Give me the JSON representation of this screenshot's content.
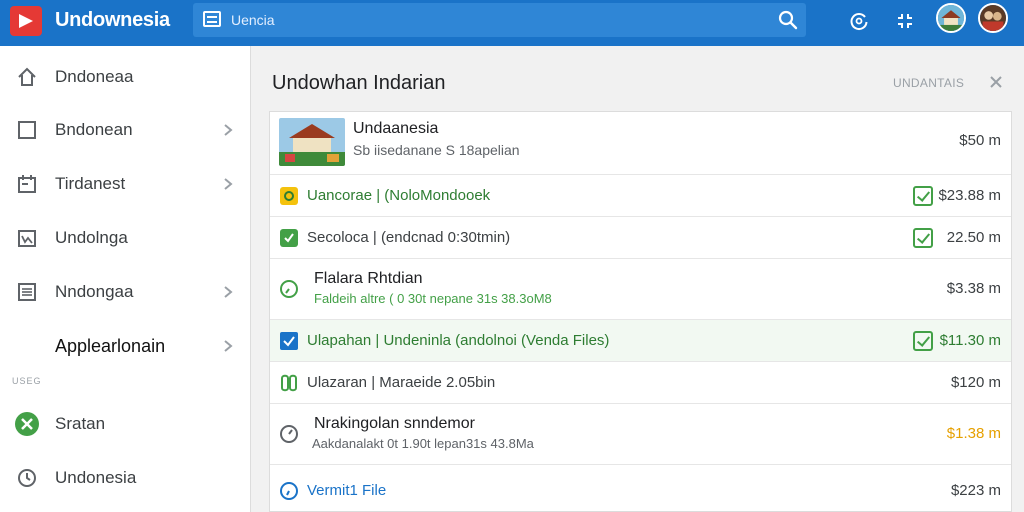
{
  "header": {
    "app_title": "Undownesia",
    "search_placeholder": "Uencia"
  },
  "sidebar": {
    "items": [
      {
        "label": "Dndoneaa",
        "icon": "home-icon"
      },
      {
        "label": "Bndonean",
        "icon": "square-icon"
      },
      {
        "label": "Tirdanest",
        "icon": "calendar-icon"
      },
      {
        "label": "Undolnga",
        "icon": "gallery-icon"
      },
      {
        "label": "Nndongaa",
        "icon": "document-icon"
      },
      {
        "label": "Applearlonain",
        "icon": ""
      },
      {
        "label": "Sratan",
        "icon": "green-circle-icon"
      },
      {
        "label": "Undonesia",
        "icon": "clock-icon"
      }
    ],
    "section_label": "USEG"
  },
  "panel": {
    "title": "Undowhan Indarian",
    "action_label": "UNDANTAIS"
  },
  "rows": [
    {
      "title": "Undaanesia",
      "subtitle": "Sb iisedanane S 18apelian",
      "amount": "$50 m",
      "icon": "thumbnail"
    },
    {
      "title": "Uancorae | (NoloMondooek",
      "amount": "$23.88 m",
      "icon": "yellow-badge-icon"
    },
    {
      "title": "Secoloca | (endcnad 0:30tmin)",
      "amount": "22.50 m",
      "icon": "green-badge-icon"
    },
    {
      "title": "Flalara Rhtdian",
      "subtitle": "Faldeih altre ( 0 30t nepane 31s 38.3oM8",
      "amount": "$3.38 m",
      "icon": "green-timer-icon"
    },
    {
      "title": "Ulapahan | Undeninla (andolnoi (Venda Files)",
      "amount": "$11.30 m",
      "icon": "blue-check-icon"
    },
    {
      "title": "Ulazaran | Maraeide 2.05bin",
      "amount": "$120 m",
      "icon": "green-loop-icon"
    },
    {
      "title": "Nrakingolan snndemor",
      "subtitle": "Aakdanalakt 0t 1.90t lepan31s 43.8Ma",
      "amount": "$1.38 m",
      "icon": "gray-timer-icon"
    },
    {
      "title": "Vermit1 File",
      "amount": "$223 m",
      "icon": "blue-timer-icon"
    }
  ],
  "colors": {
    "topbar": "#1a73c8",
    "accent_green": "#43a047",
    "accent_blue": "#1a73c8",
    "amount_orange": "#e6a000"
  }
}
